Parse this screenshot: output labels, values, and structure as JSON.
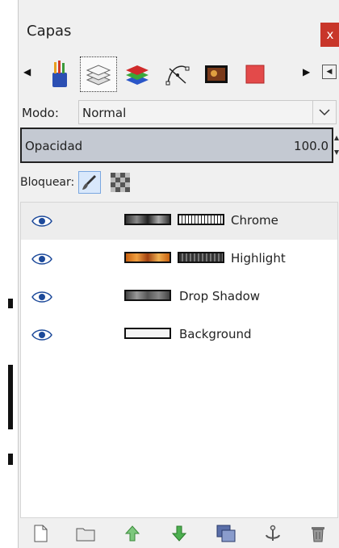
{
  "window": {
    "title": "Capas",
    "close_label": "x"
  },
  "tabs": [
    {
      "icon": "paint-brushes-icon"
    },
    {
      "icon": "layers-icon",
      "active": true
    },
    {
      "icon": "channels-icon"
    },
    {
      "icon": "paths-icon"
    },
    {
      "icon": "image-thumbnail-icon"
    },
    {
      "icon": "red-square-icon"
    }
  ],
  "mode": {
    "label": "Modo:",
    "value": "Normal"
  },
  "opacity": {
    "label": "Opacidad",
    "value": "100.0"
  },
  "lock": {
    "label": "Bloquear:"
  },
  "layers": [
    {
      "name": "Chrome",
      "selected": true
    },
    {
      "name": "Highlight"
    },
    {
      "name": "Drop Shadow"
    },
    {
      "name": "Background"
    }
  ],
  "bottom_buttons": [
    "new-layer-icon",
    "new-layer-group-icon",
    "raise-layer-icon",
    "lower-layer-icon",
    "duplicate-layer-icon",
    "anchor-layer-icon",
    "delete-layer-icon"
  ],
  "colors": {
    "close": "#c8362a",
    "opacity_bar": "#c4c9d2",
    "raise_green": "#4caf50",
    "selected_row": "#ededed"
  }
}
